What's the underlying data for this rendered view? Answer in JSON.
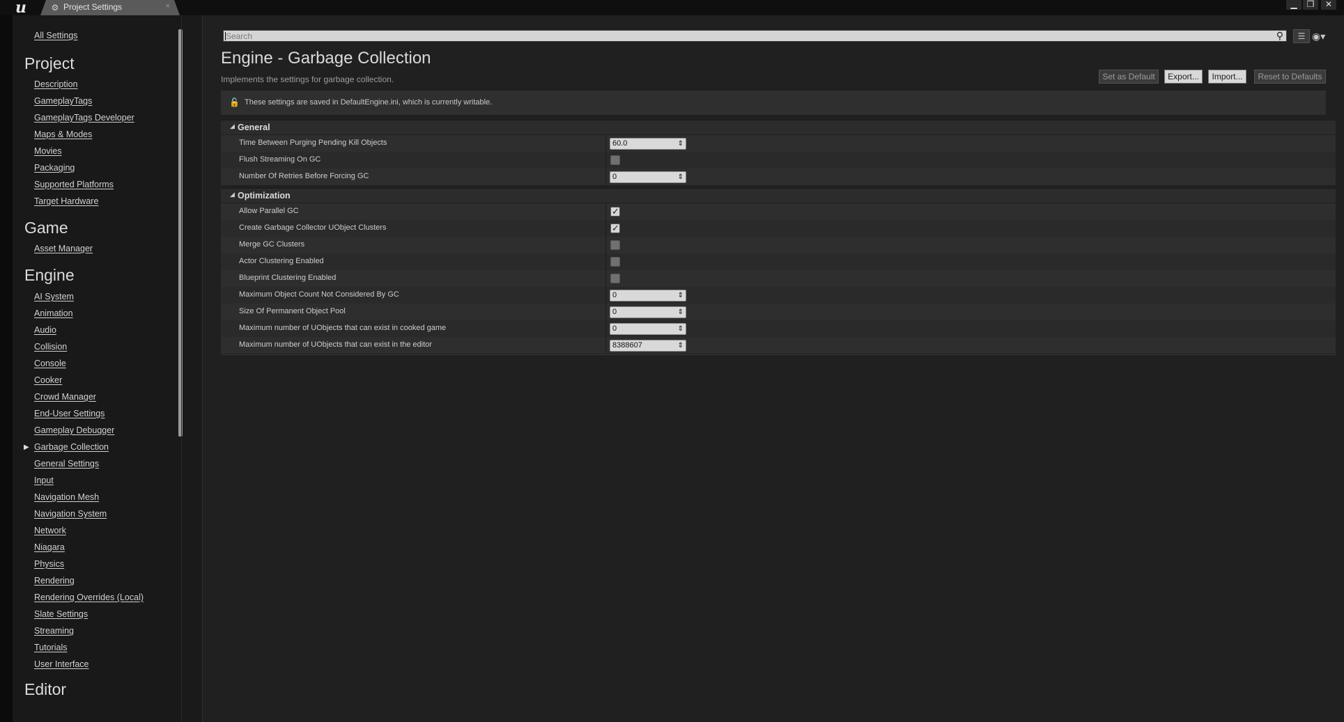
{
  "window": {
    "tab_title": "Project Settings",
    "tab_close": "×",
    "minimize": "▁",
    "restore": "❐",
    "close": "✕"
  },
  "icons": {
    "logo": "u",
    "settings": "⚙",
    "search": "⚲",
    "view_options": "☰",
    "eye": "◉▾",
    "lock": "🔓",
    "spin": "⇕",
    "check": "✓",
    "triangle_open": "◢",
    "triangle_right": "▶"
  },
  "sidebar": {
    "all_settings": "All Settings",
    "categories": [
      {
        "title": "Project",
        "items": [
          "Description",
          "GameplayTags",
          "GameplayTags Developer",
          "Maps & Modes",
          "Movies",
          "Packaging",
          "Supported Platforms",
          "Target Hardware"
        ]
      },
      {
        "title": "Game",
        "items": [
          "Asset Manager"
        ]
      },
      {
        "title": "Engine",
        "items": [
          "AI System",
          "Animation",
          "Audio",
          "Collision",
          "Console",
          "Cooker",
          "Crowd Manager",
          "End-User Settings",
          "Gameplay Debugger",
          "Garbage Collection",
          "General Settings",
          "Input",
          "Navigation Mesh",
          "Navigation System",
          "Network",
          "Niagara",
          "Physics",
          "Rendering",
          "Rendering Overrides (Local)",
          "Slate Settings",
          "Streaming",
          "Tutorials",
          "User Interface"
        ]
      },
      {
        "title": "Editor",
        "items": []
      }
    ]
  },
  "search": {
    "placeholder": "Search"
  },
  "page": {
    "title": "Engine - Garbage Collection",
    "subtitle": "Implements the settings for garbage collection.",
    "buttons": {
      "set_default": "Set as Default",
      "export": "Export...",
      "import": "Import...",
      "reset": "Reset to Defaults"
    },
    "notice": "These settings are saved in DefaultEngine.ini, which is currently writable."
  },
  "sections": {
    "general": {
      "label": "General",
      "props": [
        {
          "name": "Time Between Purging Pending Kill Objects",
          "type": "number",
          "value": "60.0"
        },
        {
          "name": "Flush Streaming On GC",
          "type": "bool",
          "value": false
        },
        {
          "name": "Number Of Retries Before Forcing GC",
          "type": "number",
          "value": "0"
        }
      ]
    },
    "optimization": {
      "label": "Optimization",
      "props": [
        {
          "name": "Allow Parallel GC",
          "type": "bool",
          "value": true
        },
        {
          "name": "Create Garbage Collector UObject Clusters",
          "type": "bool",
          "value": true
        },
        {
          "name": "Merge GC Clusters",
          "type": "bool",
          "value": false
        },
        {
          "name": "Actor Clustering Enabled",
          "type": "bool",
          "value": false
        },
        {
          "name": "Blueprint Clustering Enabled",
          "type": "bool",
          "value": false
        },
        {
          "name": "Maximum Object Count Not Considered By GC",
          "type": "number",
          "value": "0"
        },
        {
          "name": "Size Of Permanent Object Pool",
          "type": "number",
          "value": "0"
        },
        {
          "name": "Maximum number of UObjects that can exist in cooked game",
          "type": "number",
          "value": "0"
        },
        {
          "name": "Maximum number of UObjects that can exist in the editor",
          "type": "number",
          "value": "8388607"
        }
      ]
    }
  }
}
